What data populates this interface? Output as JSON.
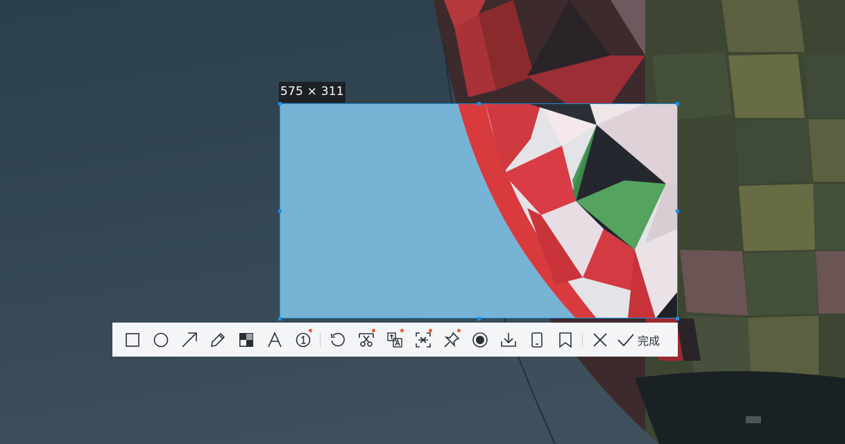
{
  "selection": {
    "size_label": "575 × 311"
  },
  "toolbar": {
    "tools": [
      {
        "name": "rectangle-tool",
        "icon": "rectangle-icon",
        "badge": false
      },
      {
        "name": "ellipse-tool",
        "icon": "circle-icon",
        "badge": false
      },
      {
        "name": "arrow-tool",
        "icon": "arrow-icon",
        "badge": false
      },
      {
        "name": "pen-tool",
        "icon": "pencil-icon",
        "badge": false
      },
      {
        "name": "mosaic-tool",
        "icon": "mosaic-icon",
        "badge": false
      },
      {
        "name": "text-tool",
        "icon": "text-icon",
        "badge": false
      },
      {
        "name": "number-marker-tool",
        "icon": "numbered-circle-icon",
        "badge": true
      },
      {
        "name": "undo-tool",
        "icon": "undo-icon",
        "badge": false
      },
      {
        "name": "scissors-tool",
        "icon": "scissors-icon",
        "badge": true
      },
      {
        "name": "translate-tool",
        "icon": "translate-icon",
        "badge": true
      },
      {
        "name": "ocr-tool",
        "icon": "text-recognition-icon",
        "badge": true
      },
      {
        "name": "pin-tool",
        "icon": "pin-icon",
        "badge": true
      },
      {
        "name": "record-tool",
        "icon": "record-icon",
        "badge": false
      },
      {
        "name": "download-tool",
        "icon": "download-icon",
        "badge": false
      },
      {
        "name": "phone-tool",
        "icon": "phone-icon",
        "badge": false
      },
      {
        "name": "bookmark-tool",
        "icon": "bookmark-icon",
        "badge": false
      }
    ],
    "cancel_icon": "close-icon",
    "done_icon": "check-icon",
    "done_label": "完成"
  },
  "colors": {
    "selection_border": "#1e8fe0",
    "badge": "#ee5a24",
    "toolbar_bg": "#f4f5f7",
    "icon": "#2a2f36"
  }
}
